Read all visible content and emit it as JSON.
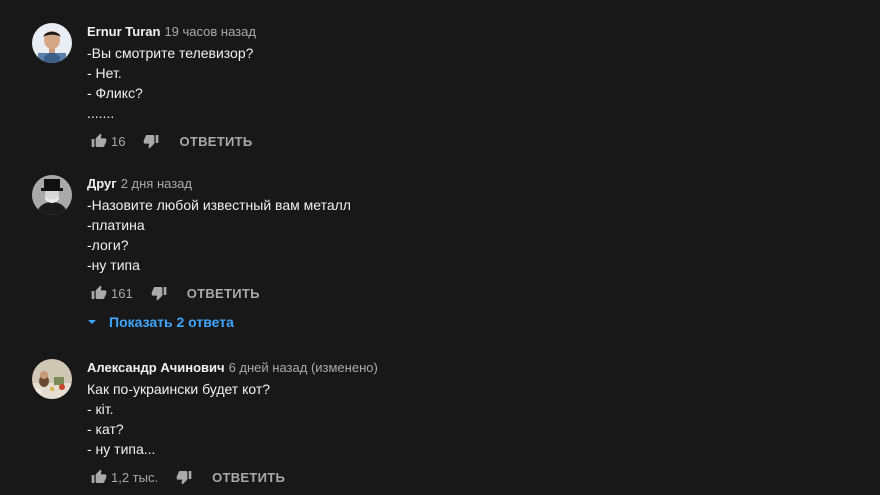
{
  "comments": [
    {
      "author": "Ernur Turan",
      "time": "19 часов назад",
      "lines": [
        "-Вы смотрите телевизор?",
        "- Нет.",
        "- Фликс?",
        "......."
      ],
      "likes": "16",
      "reply_label": "ОТВЕТИТЬ"
    },
    {
      "author": "Друг",
      "time": "2 дня назад",
      "lines": [
        "-Назовите любой известный вам металл",
        "-платина",
        "-логи?",
        "-ну типа"
      ],
      "likes": "161",
      "reply_label": "ОТВЕТИТЬ",
      "show_replies_label": "Показать 2 ответа"
    },
    {
      "author": "Александр Ачинович",
      "time": "6 дней назад (изменено)",
      "lines": [
        "Как по-украински будет кот?",
        "- кіт.",
        "- кат?",
        "- ну типа..."
      ],
      "likes": "1,2 тыс.",
      "reply_label": "ОТВЕТИТЬ"
    }
  ],
  "colors": {
    "background": "#181818",
    "text": "#f1f1f1",
    "secondary": "#aaaaaa",
    "link": "#3ea6ff"
  },
  "icons": [
    "thumb-up-icon",
    "thumb-down-icon",
    "chevron-down-icon"
  ]
}
